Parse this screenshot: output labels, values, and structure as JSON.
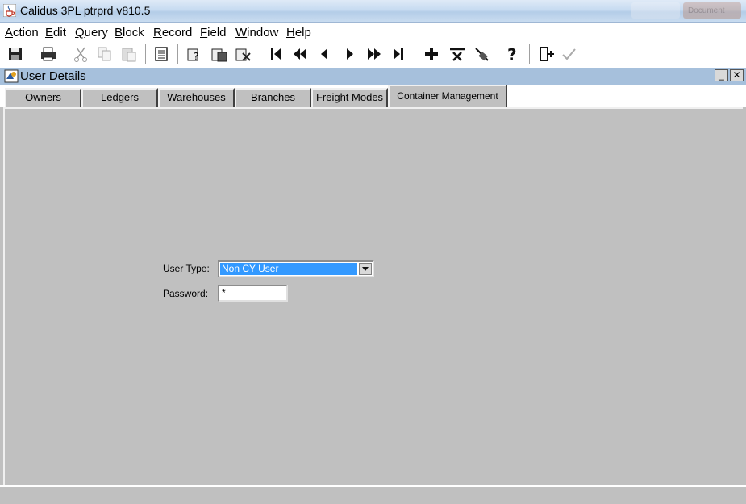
{
  "window": {
    "title": "Calidus 3PL ptrprd v810.5",
    "faded_taskbar_label": "Document"
  },
  "menubar": {
    "items": [
      {
        "first": "A",
        "rest": "ction"
      },
      {
        "first": "E",
        "rest": "dit"
      },
      {
        "first": "Q",
        "rest": "uery"
      },
      {
        "first": "B",
        "rest": "lock"
      },
      {
        "first": "R",
        "rest": "ecord"
      },
      {
        "first": "F",
        "rest": "ield"
      },
      {
        "first": "W",
        "rest": "indow"
      },
      {
        "first": "H",
        "rest": "elp"
      }
    ]
  },
  "toolbar": {
    "icons": [
      "save-icon",
      "print-icon",
      "cut-icon",
      "copy-icon",
      "paste-icon",
      "list-icon",
      "query-icon",
      "execute-query-icon",
      "cancel-query-icon",
      "first-record-icon",
      "previous-block-icon",
      "previous-record-icon",
      "next-record-icon",
      "next-block-icon",
      "last-record-icon",
      "insert-record-icon",
      "delete-record-icon",
      "clear-record-icon",
      "help-icon",
      "exit-icon",
      "commit-icon"
    ]
  },
  "form": {
    "title": "User Details",
    "min_label": "_",
    "close_label": "✕",
    "tabs": [
      "Owners",
      "Ledgers",
      "Warehouses",
      "Branches",
      "Freight Modes",
      "Container Management"
    ],
    "active_tab": "Container Management",
    "user_type_label": "User Type:",
    "user_type_value": "Non CY User",
    "password_label": "Password:",
    "password_value": "*"
  },
  "colors": {
    "selection": "#3399ff",
    "panel": "#c0c0c0",
    "inner_titlebar": "#a6c0dc"
  }
}
